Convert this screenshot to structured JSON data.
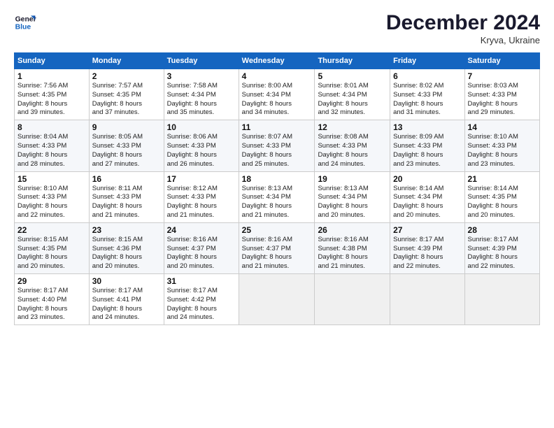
{
  "logo": {
    "line1": "General",
    "line2": "Blue"
  },
  "title": "December 2024",
  "location": "Kryva, Ukraine",
  "days_of_week": [
    "Sunday",
    "Monday",
    "Tuesday",
    "Wednesday",
    "Thursday",
    "Friday",
    "Saturday"
  ],
  "weeks": [
    [
      {
        "day": "1",
        "info": "Sunrise: 7:56 AM\nSunset: 4:35 PM\nDaylight: 8 hours\nand 39 minutes."
      },
      {
        "day": "2",
        "info": "Sunrise: 7:57 AM\nSunset: 4:35 PM\nDaylight: 8 hours\nand 37 minutes."
      },
      {
        "day": "3",
        "info": "Sunrise: 7:58 AM\nSunset: 4:34 PM\nDaylight: 8 hours\nand 35 minutes."
      },
      {
        "day": "4",
        "info": "Sunrise: 8:00 AM\nSunset: 4:34 PM\nDaylight: 8 hours\nand 34 minutes."
      },
      {
        "day": "5",
        "info": "Sunrise: 8:01 AM\nSunset: 4:34 PM\nDaylight: 8 hours\nand 32 minutes."
      },
      {
        "day": "6",
        "info": "Sunrise: 8:02 AM\nSunset: 4:33 PM\nDaylight: 8 hours\nand 31 minutes."
      },
      {
        "day": "7",
        "info": "Sunrise: 8:03 AM\nSunset: 4:33 PM\nDaylight: 8 hours\nand 29 minutes."
      }
    ],
    [
      {
        "day": "8",
        "info": "Sunrise: 8:04 AM\nSunset: 4:33 PM\nDaylight: 8 hours\nand 28 minutes."
      },
      {
        "day": "9",
        "info": "Sunrise: 8:05 AM\nSunset: 4:33 PM\nDaylight: 8 hours\nand 27 minutes."
      },
      {
        "day": "10",
        "info": "Sunrise: 8:06 AM\nSunset: 4:33 PM\nDaylight: 8 hours\nand 26 minutes."
      },
      {
        "day": "11",
        "info": "Sunrise: 8:07 AM\nSunset: 4:33 PM\nDaylight: 8 hours\nand 25 minutes."
      },
      {
        "day": "12",
        "info": "Sunrise: 8:08 AM\nSunset: 4:33 PM\nDaylight: 8 hours\nand 24 minutes."
      },
      {
        "day": "13",
        "info": "Sunrise: 8:09 AM\nSunset: 4:33 PM\nDaylight: 8 hours\nand 23 minutes."
      },
      {
        "day": "14",
        "info": "Sunrise: 8:10 AM\nSunset: 4:33 PM\nDaylight: 8 hours\nand 23 minutes."
      }
    ],
    [
      {
        "day": "15",
        "info": "Sunrise: 8:10 AM\nSunset: 4:33 PM\nDaylight: 8 hours\nand 22 minutes."
      },
      {
        "day": "16",
        "info": "Sunrise: 8:11 AM\nSunset: 4:33 PM\nDaylight: 8 hours\nand 21 minutes."
      },
      {
        "day": "17",
        "info": "Sunrise: 8:12 AM\nSunset: 4:33 PM\nDaylight: 8 hours\nand 21 minutes."
      },
      {
        "day": "18",
        "info": "Sunrise: 8:13 AM\nSunset: 4:34 PM\nDaylight: 8 hours\nand 21 minutes."
      },
      {
        "day": "19",
        "info": "Sunrise: 8:13 AM\nSunset: 4:34 PM\nDaylight: 8 hours\nand 20 minutes."
      },
      {
        "day": "20",
        "info": "Sunrise: 8:14 AM\nSunset: 4:34 PM\nDaylight: 8 hours\nand 20 minutes."
      },
      {
        "day": "21",
        "info": "Sunrise: 8:14 AM\nSunset: 4:35 PM\nDaylight: 8 hours\nand 20 minutes."
      }
    ],
    [
      {
        "day": "22",
        "info": "Sunrise: 8:15 AM\nSunset: 4:35 PM\nDaylight: 8 hours\nand 20 minutes."
      },
      {
        "day": "23",
        "info": "Sunrise: 8:15 AM\nSunset: 4:36 PM\nDaylight: 8 hours\nand 20 minutes."
      },
      {
        "day": "24",
        "info": "Sunrise: 8:16 AM\nSunset: 4:37 PM\nDaylight: 8 hours\nand 20 minutes."
      },
      {
        "day": "25",
        "info": "Sunrise: 8:16 AM\nSunset: 4:37 PM\nDaylight: 8 hours\nand 21 minutes."
      },
      {
        "day": "26",
        "info": "Sunrise: 8:16 AM\nSunset: 4:38 PM\nDaylight: 8 hours\nand 21 minutes."
      },
      {
        "day": "27",
        "info": "Sunrise: 8:17 AM\nSunset: 4:39 PM\nDaylight: 8 hours\nand 22 minutes."
      },
      {
        "day": "28",
        "info": "Sunrise: 8:17 AM\nSunset: 4:39 PM\nDaylight: 8 hours\nand 22 minutes."
      }
    ],
    [
      {
        "day": "29",
        "info": "Sunrise: 8:17 AM\nSunset: 4:40 PM\nDaylight: 8 hours\nand 23 minutes."
      },
      {
        "day": "30",
        "info": "Sunrise: 8:17 AM\nSunset: 4:41 PM\nDaylight: 8 hours\nand 24 minutes."
      },
      {
        "day": "31",
        "info": "Sunrise: 8:17 AM\nSunset: 4:42 PM\nDaylight: 8 hours\nand 24 minutes."
      },
      {
        "day": "",
        "info": ""
      },
      {
        "day": "",
        "info": ""
      },
      {
        "day": "",
        "info": ""
      },
      {
        "day": "",
        "info": ""
      }
    ]
  ],
  "colors": {
    "header_bg": "#1565c0",
    "row_alt": "#f5f7fa"
  }
}
